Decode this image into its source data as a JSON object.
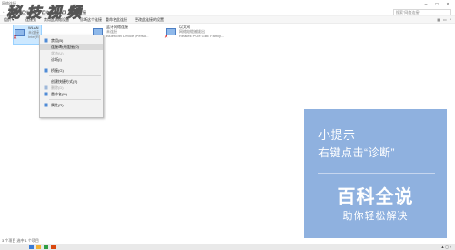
{
  "window": {
    "title": "网络连接"
  },
  "nav": {
    "path": [
      "控制面板",
      "网络和 Internet",
      "网络连接"
    ],
    "search_placeholder": "搜索\"网络连接\""
  },
  "toolbar": {
    "items": [
      "组织 ▾",
      "连接到",
      "禁用此网络设备",
      "诊断这个连接",
      "重命名此连接",
      "更改此连接的设置"
    ]
  },
  "adapters": [
    {
      "name": "WLAN",
      "status": "未连接",
      "device": "Intel(R) Dual Band Wireless..."
    },
    {
      "name": "蓝牙网络连接",
      "status": "未连接",
      "device": "Bluetooth Device (Perso..."
    },
    {
      "name": "以太网",
      "status": "网络电缆被拔出",
      "device": "Realtek PCIe GBE Family..."
    }
  ],
  "watermark": {
    "text": "秘·技·视·频"
  },
  "context_menu": {
    "items": [
      {
        "label": "禁用(B)",
        "state": "normal"
      },
      {
        "label": "连接/断开连接(O)",
        "state": "highlight"
      },
      {
        "label": "状态(U)",
        "state": "disabled"
      },
      {
        "label": "诊断(I)",
        "state": "normal"
      },
      {
        "label": "桥接(G)",
        "state": "normal"
      },
      {
        "label": "创建快捷方式(S)",
        "state": "normal"
      },
      {
        "label": "删除(D)",
        "state": "disabled"
      },
      {
        "label": "重命名(M)",
        "state": "normal"
      },
      {
        "label": "属性(R)",
        "state": "normal"
      }
    ]
  },
  "tip": {
    "title": "小提示",
    "text": "右键点击“诊断”",
    "brand_name": "百科全说",
    "brand_slogan": "助你轻松解决"
  },
  "status": {
    "text": "3 个项目   选中 1 个项目"
  },
  "colors": {
    "tip_bg": "#8fb1df",
    "selection": "#cce8ff",
    "error": "#d80000"
  }
}
